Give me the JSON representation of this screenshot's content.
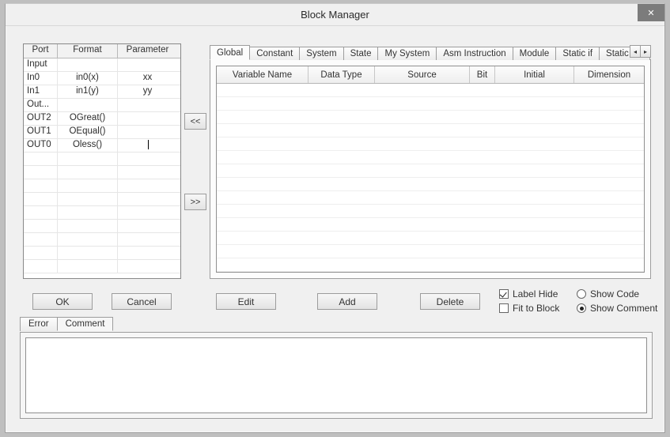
{
  "window": {
    "title": "Block Manager",
    "close_glyph": "✕"
  },
  "port_table": {
    "headers": {
      "port": "Port",
      "format": "Format",
      "parameter": "Parameter"
    },
    "rows": [
      {
        "port": "Input",
        "format": "",
        "parameter": ""
      },
      {
        "port": "In0",
        "format": "in0(x)",
        "parameter": "xx"
      },
      {
        "port": "In1",
        "format": "in1(y)",
        "parameter": "yy"
      },
      {
        "port": "Out...",
        "format": "",
        "parameter": ""
      },
      {
        "port": "OUT2",
        "format": "OGreat()",
        "parameter": ""
      },
      {
        "port": "OUT1",
        "format": "OEqual()",
        "parameter": ""
      },
      {
        "port": "OUT0",
        "format": "Oless()",
        "parameter": "",
        "editing_param": true
      }
    ]
  },
  "transfer": {
    "left": "<<",
    "right": ">>"
  },
  "var_tabs": {
    "items": [
      "Global",
      "Constant",
      "System",
      "State",
      "My System",
      "Asm Instruction",
      "Module",
      "Static if",
      "Static set"
    ],
    "active_index": 0,
    "spin_left": "◂",
    "spin_right": "▸"
  },
  "grid": {
    "headers": {
      "variable": "Variable Name",
      "datatype": "Data Type",
      "source": "Source",
      "bit": "Bit",
      "initial": "Initial",
      "dimension": "Dimension"
    }
  },
  "buttons": {
    "ok": "OK",
    "cancel": "Cancel",
    "edit": "Edit",
    "add": "Add",
    "delete": "Delete"
  },
  "options": {
    "label_hide": "Label Hide",
    "fit_to_block": "Fit to Block",
    "show_code": "Show Code",
    "show_comment": "Show Comment",
    "label_hide_checked": true,
    "fit_to_block_checked": false,
    "show_mode": "comment"
  },
  "bottom_tabs": {
    "items": [
      "Error",
      "Comment"
    ],
    "active_index": 1
  }
}
